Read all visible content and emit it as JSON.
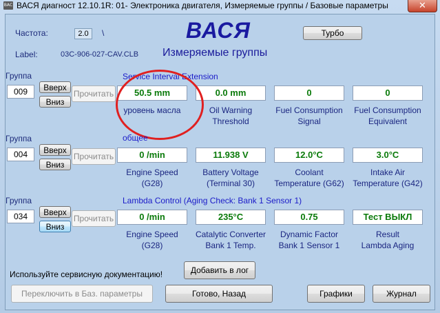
{
  "window": {
    "icon_text": "ВАС",
    "title": "ВАСЯ диагност 12.10.1R: 01- Электроника двигателя,  Измеряемые группы / Базовые параметры",
    "close_label": "✕"
  },
  "header": {
    "app_name": "ВАСЯ",
    "subtitle": "Измеряемые группы",
    "freq_label": "Частота:",
    "freq_value": "2.0",
    "freq_suffix": "\\",
    "label_caption": "Label:",
    "label_value": "03C-906-027-CAV.CLB",
    "turbo_button": "Турбо"
  },
  "groups": [
    {
      "caption": "Группа",
      "number": "009",
      "up_label": "Вверх",
      "down_label": "Вниз",
      "read_label": "Прочитать",
      "title": "Service Interval Extension",
      "fields": [
        {
          "value": "50.5 mm",
          "desc1": "уровень масла",
          "desc2": ""
        },
        {
          "value": "0.0 mm",
          "desc1": "Oil Warning",
          "desc2": "Threshold"
        },
        {
          "value": "0",
          "desc1": "Fuel Consumption",
          "desc2": "Signal"
        },
        {
          "value": "0",
          "desc1": "Fuel Consumption",
          "desc2": "Equivalent"
        }
      ]
    },
    {
      "caption": "Группа",
      "number": "004",
      "up_label": "Вверх",
      "down_label": "Вниз",
      "read_label": "Прочитать",
      "title": "общее",
      "fields": [
        {
          "value": "0 /min",
          "desc1": "Engine Speed",
          "desc2": "(G28)"
        },
        {
          "value": "11.938 V",
          "desc1": "Battery Voltage",
          "desc2": "(Terminal 30)"
        },
        {
          "value": "12.0°C",
          "desc1": "Coolant",
          "desc2": "Temperature (G62)"
        },
        {
          "value": "3.0°C",
          "desc1": "Intake Air",
          "desc2": "Temperature (G42)"
        }
      ]
    },
    {
      "caption": "Группа",
      "number": "034",
      "up_label": "Вверх",
      "down_label": "Вниз",
      "read_label": "Прочитать",
      "title": "Lambda Control (Aging Check: Bank 1 Sensor 1)",
      "fields": [
        {
          "value": "0 /min",
          "desc1": "Engine Speed",
          "desc2": "(G28)"
        },
        {
          "value": "235°C",
          "desc1": "Catalytic Converter",
          "desc2": "Bank 1 Temp."
        },
        {
          "value": "0.75",
          "desc1": "Dynamic Factor",
          "desc2": "Bank 1 Sensor 1"
        },
        {
          "value": "Тест ВЫКЛ",
          "desc1": "Result",
          "desc2": "Lambda Aging"
        }
      ]
    }
  ],
  "footer": {
    "doc_hint": "Используйте сервисную документацию!",
    "add_log": "Добавить в лог",
    "switch_basic": "Переключить в Баз. параметры",
    "done_back": "Готово, Назад",
    "graphs": "Графики",
    "journal": "Журнал"
  },
  "colors": {
    "value_text": "#0a7a0a",
    "annotation_circle": "#e02020",
    "background": "#b9d1ea"
  }
}
